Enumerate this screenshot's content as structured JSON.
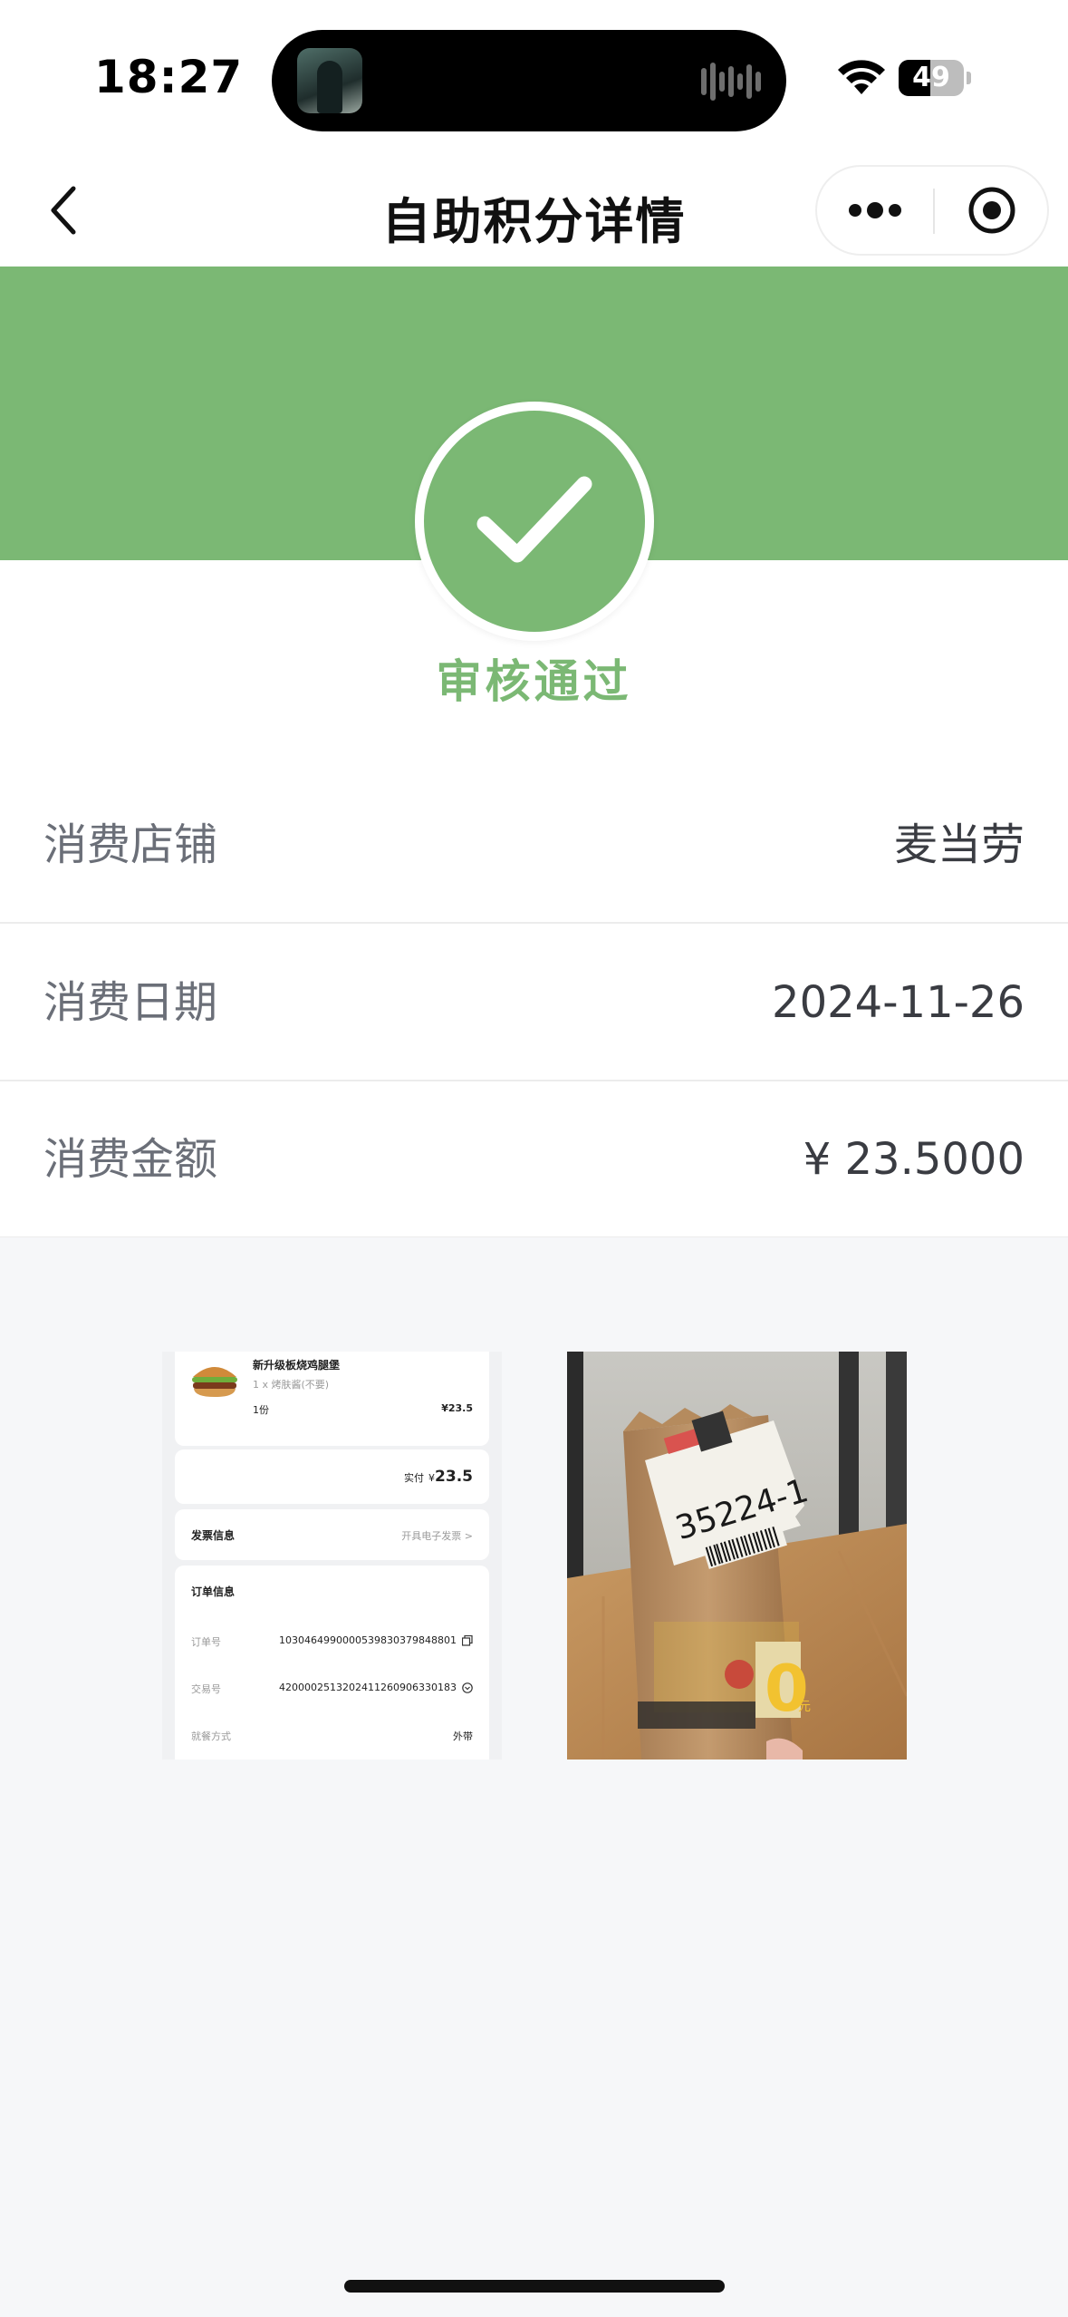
{
  "status_bar": {
    "time": "18:27",
    "battery": "49",
    "battery_level": 0.49,
    "icons": [
      "album-art-icon",
      "audio-waveform-icon",
      "wifi-icon",
      "battery-icon"
    ]
  },
  "nav": {
    "title": "自助积分详情",
    "icons": [
      "back-chevron-icon",
      "more-dots-icon",
      "close-target-icon"
    ]
  },
  "colors": {
    "accent_green": "#7bb874",
    "label_grey": "#6b6f78",
    "value_dark": "#3a3c42",
    "page_background": "#f6f7f9"
  },
  "review": {
    "status": "审核通过",
    "icon": "checkmark-icon"
  },
  "details": [
    {
      "label": "消费店铺",
      "value": "麦当劳"
    },
    {
      "label": "消费日期",
      "value": "2024-11-26"
    },
    {
      "label": "消费金额",
      "value": "¥ 23.5000"
    }
  ],
  "receipt_screenshot": {
    "item_name": "新升级板烧鸡腿堡",
    "item_option": "1 x 烤肤酱(不要)",
    "item_qty": "1份",
    "item_price": "¥23.5",
    "paid_label": "实付",
    "paid_currency": "¥",
    "paid_amount": "23.5",
    "invoice_label": "发票信息",
    "invoice_action": "开具电子发票 >",
    "order_info_label": "订单信息",
    "order_no_label": "订单号",
    "order_no": "1030464990000539830379848801",
    "trade_no_label": "交易号",
    "trade_no": "4200002513202411260906330183",
    "dining_label": "就餐方式",
    "dining_value": "外带"
  },
  "bag_photo": {
    "ticket_number": "35224-1",
    "promo_number": "0",
    "promo_unit": "元"
  }
}
